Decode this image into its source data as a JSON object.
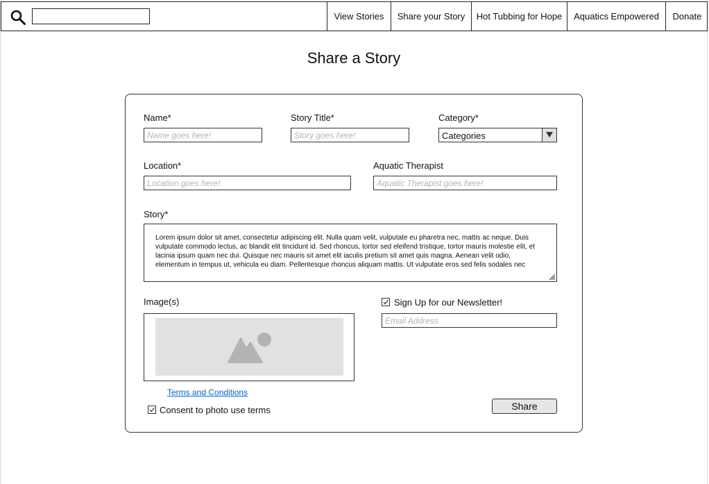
{
  "header": {
    "search_placeholder": "",
    "nav": [
      {
        "label": "View Stories"
      },
      {
        "label": "Share your Story"
      },
      {
        "label": "Hot Tubbing for Hope"
      },
      {
        "label": "Aquatics Empowered"
      },
      {
        "label": "Donate"
      }
    ]
  },
  "page": {
    "title": "Share a Story"
  },
  "form": {
    "name": {
      "label": "Name*",
      "placeholder": "Name goes here!"
    },
    "story_title": {
      "label": "Story Title*",
      "placeholder": "Story goes here!"
    },
    "category": {
      "label": "Category*",
      "value": "Categories"
    },
    "location": {
      "label": "Location*",
      "placeholder": "Location goes here!"
    },
    "therapist": {
      "label": "Aquatic Therapist",
      "placeholder": "Aquatic Therapist goes here!"
    },
    "story": {
      "label": "Story*",
      "text": "Lorem ipsum dolor sit amet, consectetur adipiscing elit. Nulla quam velit, vulputate eu pharetra nec, mattis ac neque. Duis vulputate commodo lectus, ac blandit elit tincidunt id. Sed rhoncus, tortor sed eleifend tristique, tortor mauris molestie elit, et lacinia ipsum quam nec dui. Quisque nec mauris sit amet elit iaculis pretium sit amet quis magna. Aenean velit odio, elementum in tempus ut, vehicula eu diam. Pellentesque rhoncus aliquam mattis. Ut vulputate eros sed felis sodales nec"
    },
    "images": {
      "label": "Image(s)",
      "icon": "image-placeholder-icon"
    },
    "newsletter": {
      "label": "Sign Up for our Newsletter!",
      "checked": true,
      "email_placeholder": "Email Address"
    },
    "terms_link": "Terms and Conditions",
    "consent": {
      "label": "Consent to photo use terms",
      "checked": true
    },
    "submit_label": "Share"
  },
  "colors": {
    "link": "#0a5fd1",
    "placeholder_bg": "#e1e1e1",
    "button_bg": "#e6e6e6"
  }
}
